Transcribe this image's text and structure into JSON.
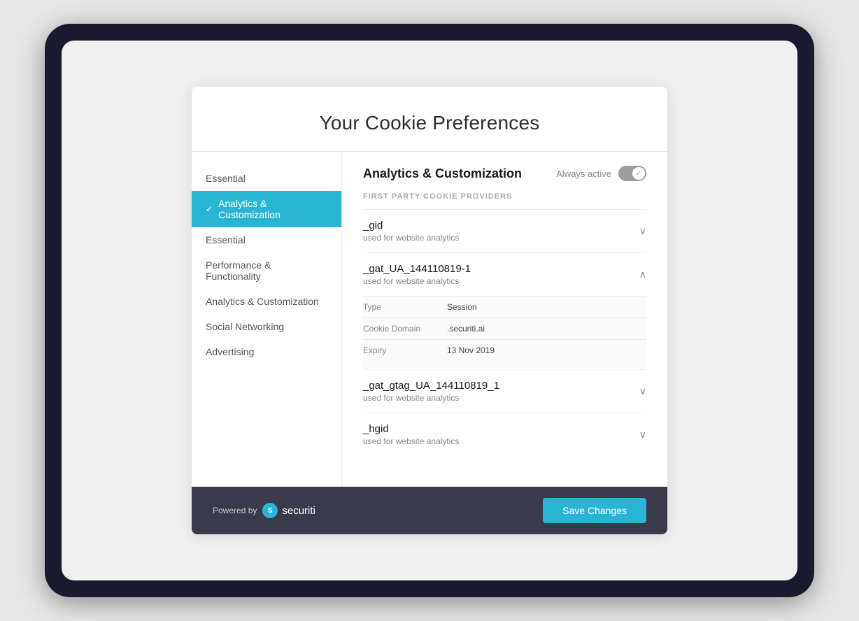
{
  "page": {
    "title": "Your Cookie Preferences",
    "divider": true
  },
  "sidebar": {
    "items": [
      {
        "id": "essential-top",
        "label": "Essential",
        "active": false
      },
      {
        "id": "analytics-customization",
        "label": "Analytics & Customization",
        "active": true
      },
      {
        "id": "essential-sub",
        "label": "Essential",
        "active": false
      },
      {
        "id": "performance-functionality",
        "label": "Performance & Functionality",
        "active": false
      },
      {
        "id": "analytics-customization-sub",
        "label": "Analytics & Customization",
        "active": false
      },
      {
        "id": "social-networking",
        "label": "Social Networking",
        "active": false
      },
      {
        "id": "advertising",
        "label": "Advertising",
        "active": false
      }
    ]
  },
  "main": {
    "panel_title": "Analytics & Customization",
    "always_active_label": "Always active",
    "section_label": "FIRST PARTY COOKIE PROVIDERS",
    "cookies": [
      {
        "id": "gid",
        "name": "_gid",
        "description": "used for website analytics",
        "expanded": false
      },
      {
        "id": "gat_ua",
        "name": "_gat_UA_144110819-1",
        "description": "used for website analytics",
        "expanded": true,
        "details": [
          {
            "key": "Type",
            "value": "Session"
          },
          {
            "key": "Cookie Domain",
            "value": ".securiti.ai"
          },
          {
            "key": "Expiry",
            "value": "13 Nov 2019"
          }
        ]
      },
      {
        "id": "gat_gtag",
        "name": "_gat_gtag_UA_144110819_1",
        "description": "used for website analytics",
        "expanded": false
      },
      {
        "id": "hgid",
        "name": "_hgid",
        "description": "used for website analytics",
        "expanded": false
      }
    ]
  },
  "footer": {
    "powered_by": "Powered by",
    "brand_name": "securiti",
    "save_button": "Save Changes"
  },
  "icons": {
    "check": "✓",
    "chevron_down": "∨",
    "chevron_up": "∧"
  }
}
